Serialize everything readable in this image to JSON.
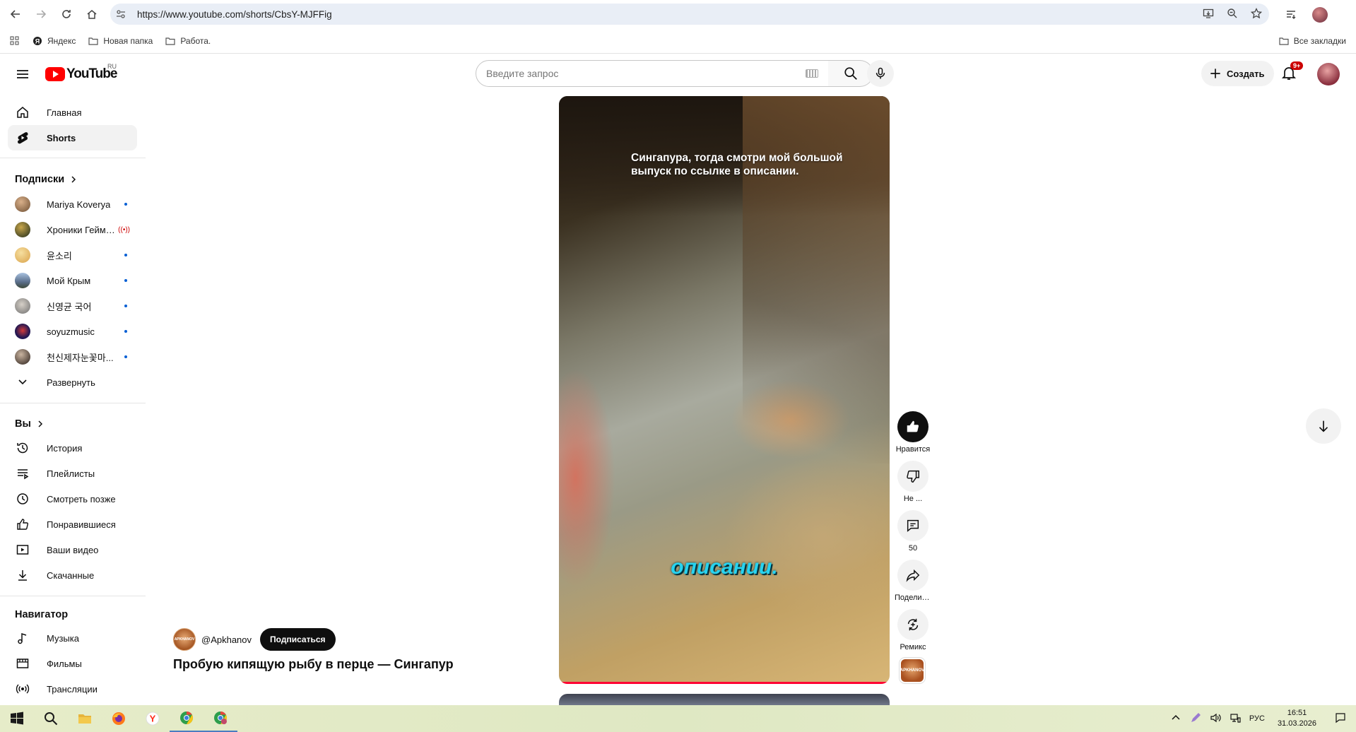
{
  "browser": {
    "url": "https://www.youtube.com/shorts/CbsY-MJFFig",
    "bookmarks": [
      "Яндекс",
      "Новая папка",
      "Работа."
    ],
    "all_bookmarks": "Все закладки"
  },
  "header": {
    "logo_text": "YouTube",
    "country_code": "RU",
    "search_placeholder": "Введите запрос",
    "create_label": "Создать",
    "notifications_badge": "9+"
  },
  "sidebar": {
    "main_items": [
      {
        "label": "Главная",
        "icon": "home-icon"
      },
      {
        "label": "Shorts",
        "icon": "shorts-icon",
        "active": true
      }
    ],
    "subscriptions_title": "Подписки",
    "subscriptions": [
      {
        "label": "Mariya Koverya",
        "indicator": "dot",
        "color": "#b58f6a"
      },
      {
        "label": "Хроники Гейме...",
        "indicator": "live",
        "color": "#2f3b2a"
      },
      {
        "label": "윤소리",
        "indicator": "dot",
        "color": "#e9c27a"
      },
      {
        "label": "Мой Крым",
        "indicator": "dot",
        "color": "#7a93b8"
      },
      {
        "label": "신영균 국어",
        "indicator": "dot",
        "color": "#9a9a9a"
      },
      {
        "label": "soyuzmusic",
        "indicator": "dot",
        "color": "#3b2a6e"
      },
      {
        "label": "천신제자눈꽃마...",
        "indicator": "dot",
        "color": "#4a3a30"
      }
    ],
    "expand_label": "Развернуть",
    "you_title": "Вы",
    "you_items": [
      {
        "label": "История",
        "icon": "history-icon"
      },
      {
        "label": "Плейлисты",
        "icon": "playlists-icon"
      },
      {
        "label": "Смотреть позже",
        "icon": "watch-later-icon"
      },
      {
        "label": "Понравившиеся",
        "icon": "liked-icon"
      },
      {
        "label": "Ваши видео",
        "icon": "your-videos-icon"
      },
      {
        "label": "Скачанные",
        "icon": "downloads-icon"
      }
    ],
    "navigator_title": "Навигатор",
    "navigator_items": [
      {
        "label": "Музыка",
        "icon": "music-icon"
      },
      {
        "label": "Фильмы",
        "icon": "movies-icon"
      },
      {
        "label": "Трансляции",
        "icon": "live-icon"
      }
    ]
  },
  "short": {
    "caption_top": "Сингапура, тогда смотри мой большой выпуск по ссылке в описании.",
    "subtitle": "описании.",
    "channel": "@Apkhanov",
    "channel_avatar_text": "APKHANOV",
    "subscribe_label": "Подписаться",
    "title": "Пробую кипящую рыбу в перце — Сингапур ...",
    "progress_fraction": 1.0
  },
  "actions": [
    {
      "label": "Нравится",
      "icon": "like-icon",
      "dark": true
    },
    {
      "label": "Не ...",
      "icon": "dislike-icon"
    },
    {
      "label": "50",
      "icon": "comment-icon"
    },
    {
      "label": "Поделить...",
      "icon": "share-icon"
    },
    {
      "label": "Ремикс",
      "icon": "remix-icon"
    }
  ],
  "taskbar": {
    "language": "РУС",
    "time": "16:51",
    "date": "31.03.2026"
  }
}
